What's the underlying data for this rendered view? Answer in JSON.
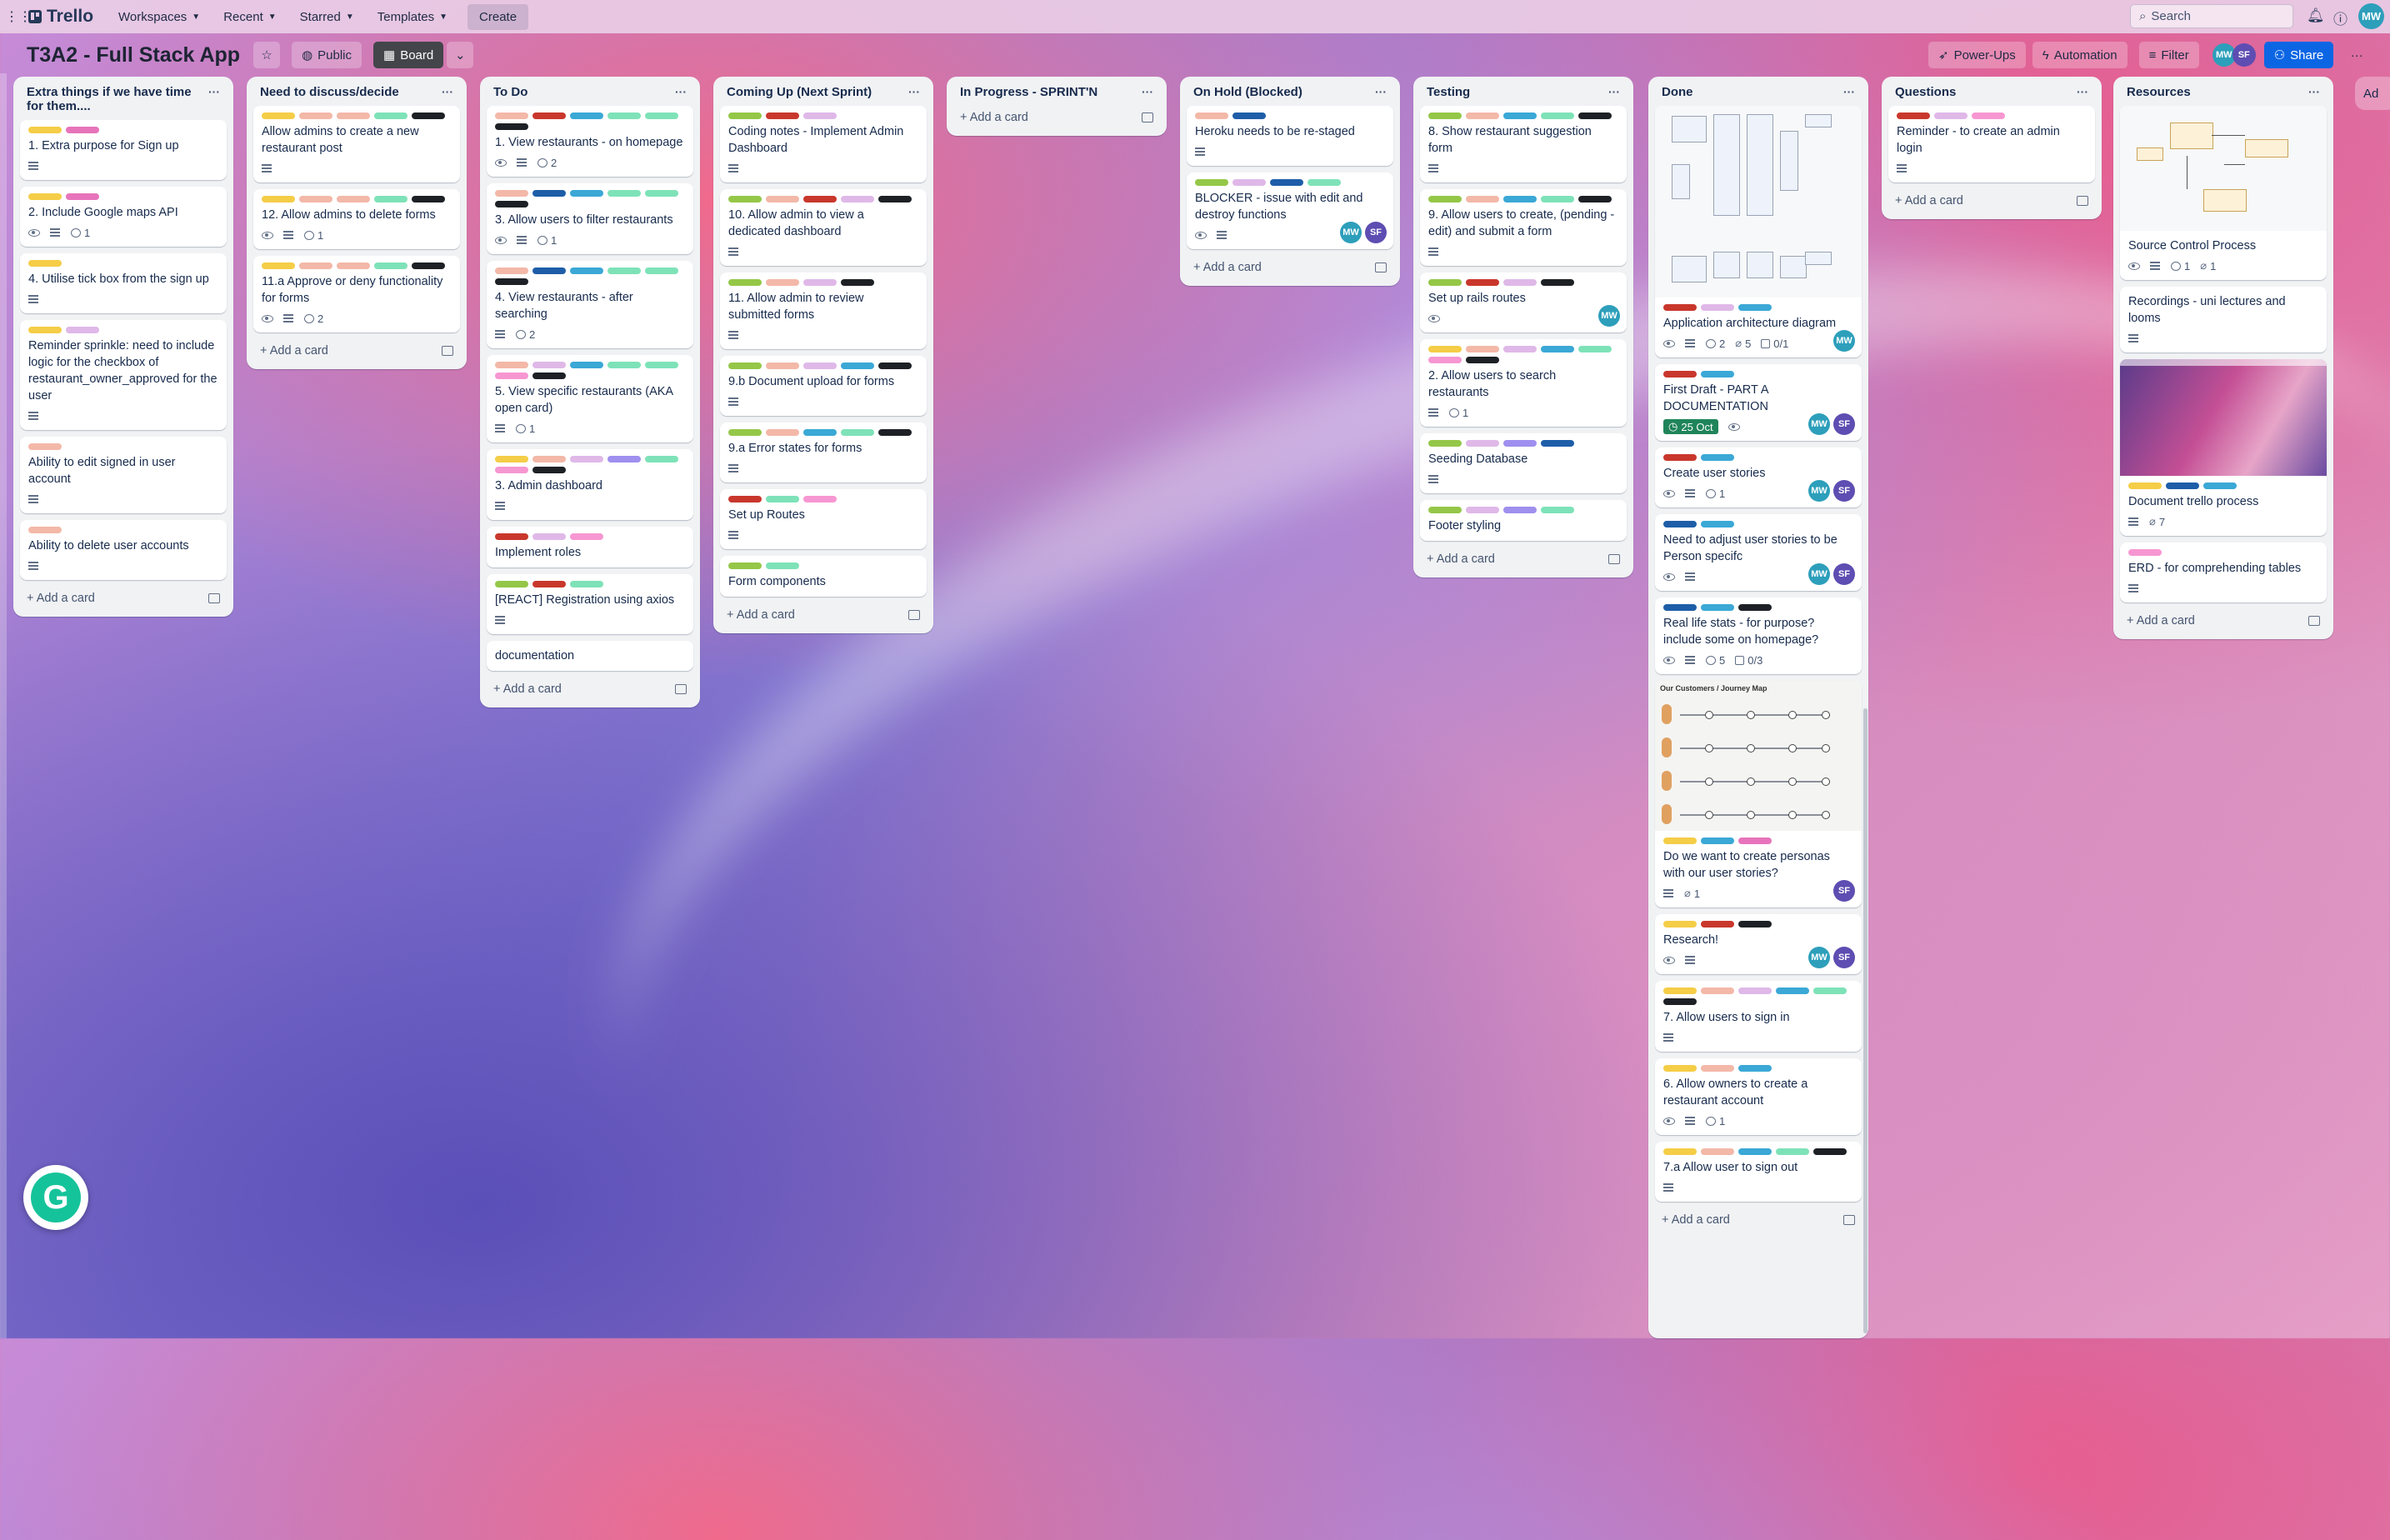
{
  "nav": {
    "logo": "Trello",
    "items": [
      "Workspaces",
      "Recent",
      "Starred",
      "Templates"
    ],
    "create": "Create",
    "search_placeholder": "Search",
    "user_initials": "MW"
  },
  "board": {
    "title": "T3A2 - Full Stack App",
    "visibility": "Public",
    "view": "Board",
    "powerups": "Power-Ups",
    "automation": "Automation",
    "filter": "Filter",
    "share": "Share",
    "member1": "MW",
    "member2": "SF"
  },
  "add_card_label": "Add a card",
  "add_list_label": "Ad",
  "colors": {
    "yellow": "#e2b203",
    "pink": "#e774bb",
    "salmon": "#f87462",
    "peach": "#f3b8a8",
    "green": "#4bce97",
    "lgreen": "#7ee2b8",
    "lime": "#94c748",
    "blue": "#579dff",
    "cyan": "#6cc3e0",
    "navy": "#1d2125",
    "teal": "#60c6d2",
    "red": "#c9372c",
    "lavender": "#dfb8e8",
    "purple": "#9f8fef",
    "dblue": "#0c66e4",
    "sky": "#3ba8d6",
    "darkblue": "#1e5ea8",
    "lpink": "#f797d2",
    "orange": "#fea362",
    "lyellow": "#f5cd47"
  },
  "lists": [
    {
      "title": "Extra things if we have time for them....",
      "cards": [
        {
          "labels": [
            "lyellow",
            "pink"
          ],
          "title": "1. Extra purpose for Sign up",
          "desc": true
        },
        {
          "labels": [
            "lyellow",
            "pink"
          ],
          "title": "2. Include Google maps API",
          "eye": true,
          "desc": true,
          "comments": "1"
        },
        {
          "labels": [
            "lyellow"
          ],
          "title": "4. Utilise tick box from the sign up",
          "desc": true
        },
        {
          "labels": [
            "lyellow",
            "lavender"
          ],
          "title": "Reminder sprinkle: need to include logic for the checkbox of restaurant_owner_approved for the user",
          "desc": true
        },
        {
          "labels": [
            "peach"
          ],
          "title": "Ability to edit signed in user account",
          "desc": true
        },
        {
          "labels": [
            "peach"
          ],
          "title": "Ability to delete user accounts",
          "desc": true
        }
      ]
    },
    {
      "title": "Need to discuss/decide",
      "cards": [
        {
          "labels": [
            "lyellow",
            "peach",
            "peach",
            "lgreen",
            "navy"
          ],
          "title": "Allow admins to create a new restaurant post",
          "desc": true
        },
        {
          "labels": [
            "lyellow",
            "peach",
            "peach",
            "lgreen",
            "navy"
          ],
          "title": "12. Allow admins to delete forms",
          "eye": true,
          "desc": true,
          "comments": "1"
        },
        {
          "labels": [
            "lyellow",
            "peach",
            "peach",
            "lgreen",
            "navy"
          ],
          "title": "11.a Approve or deny functionality for forms",
          "eye": true,
          "desc": true,
          "comments": "2"
        }
      ]
    },
    {
      "title": "To Do",
      "cards": [
        {
          "labels": [
            "peach",
            "red",
            "sky",
            "lgreen",
            "lgreen",
            "navy"
          ],
          "title": "1. View restaurants - on homepage",
          "eye": true,
          "desc": true,
          "comments": "2"
        },
        {
          "labels": [
            "peach",
            "darkblue",
            "sky",
            "lgreen",
            "lgreen",
            "navy"
          ],
          "title": "3. Allow users to filter restaurants",
          "eye": true,
          "desc": true,
          "comments": "1"
        },
        {
          "labels": [
            "peach",
            "darkblue",
            "sky",
            "lgreen",
            "lgreen",
            "navy"
          ],
          "title": "4. View restaurants - after searching",
          "desc": true,
          "comments": "2"
        },
        {
          "labels": [
            "peach",
            "lavender",
            "sky",
            "lgreen",
            "lgreen",
            "lpink",
            "navy"
          ],
          "title": "5. View specific restaurants (AKA open card)",
          "desc": true,
          "comments": "1"
        },
        {
          "labels": [
            "lyellow",
            "peach",
            "lavender",
            "purple",
            "lgreen",
            "lpink",
            "navy"
          ],
          "title": "3. Admin dashboard",
          "desc": true
        },
        {
          "labels": [
            "red",
            "lavender",
            "lpink"
          ],
          "title": "Implement roles"
        },
        {
          "labels": [
            "lime",
            "red",
            "lgreen"
          ],
          "title": "[REACT] Registration using axios",
          "desc": true
        },
        {
          "labels": [],
          "title": "documentation"
        }
      ]
    },
    {
      "title": "Coming Up (Next Sprint)",
      "cards": [
        {
          "labels": [
            "lime",
            "red",
            "lavender"
          ],
          "title": "Coding notes - Implement Admin Dashboard",
          "desc": true
        },
        {
          "labels": [
            "lime",
            "peach",
            "red",
            "lavender",
            "navy"
          ],
          "title": "10. Allow admin to view a dedicated dashboard",
          "desc": true
        },
        {
          "labels": [
            "lime",
            "peach",
            "lavender",
            "navy"
          ],
          "title": "11. Allow admin to review submitted forms",
          "desc": true
        },
        {
          "labels": [
            "lime",
            "peach",
            "lavender",
            "sky",
            "navy"
          ],
          "title": "9.b Document upload for forms",
          "desc": true
        },
        {
          "labels": [
            "lime",
            "peach",
            "sky",
            "lgreen",
            "navy"
          ],
          "title": "9.a Error states for forms",
          "desc": true
        },
        {
          "labels": [
            "red",
            "lgreen",
            "lpink"
          ],
          "title": "Set up Routes",
          "desc": true
        },
        {
          "labels": [
            "lime",
            "lgreen"
          ],
          "title": "Form components"
        }
      ]
    },
    {
      "title": "In Progress - SPRINT'N",
      "cards": []
    },
    {
      "title": "On Hold (Blocked)",
      "cards": [
        {
          "labels": [
            "peach",
            "darkblue"
          ],
          "title": "Heroku needs to be re-staged",
          "desc": true
        },
        {
          "labels": [
            "lime",
            "lavender",
            "darkblue",
            "lgreen"
          ],
          "title": "BLOCKER - issue with edit and destroy functions",
          "eye": true,
          "desc": true,
          "members": [
            "MW",
            "SF"
          ]
        }
      ]
    },
    {
      "title": "Testing",
      "cards": [
        {
          "labels": [
            "lime",
            "peach",
            "sky",
            "lgreen",
            "navy"
          ],
          "title": "8. Show restaurant suggestion form",
          "desc": true
        },
        {
          "labels": [
            "lime",
            "peach",
            "sky",
            "lgreen",
            "navy"
          ],
          "title": "9. Allow users to create, (pending - edit) and submit a form",
          "desc": true
        },
        {
          "labels": [
            "lime",
            "red",
            "lavender",
            "navy"
          ],
          "title": "Set up rails routes",
          "eye": true,
          "members": [
            "MW"
          ]
        },
        {
          "labels": [
            "lyellow",
            "peach",
            "lavender",
            "sky",
            "lgreen",
            "lpink",
            "navy"
          ],
          "title": "2. Allow users to search restaurants",
          "desc": true,
          "comments": "1"
        },
        {
          "labels": [
            "lime",
            "lavender",
            "purple",
            "darkblue"
          ],
          "title": "Seeding Database",
          "desc": true
        },
        {
          "labels": [
            "lime",
            "lavender",
            "purple",
            "lgreen"
          ],
          "title": "Footer styling"
        }
      ]
    },
    {
      "title": "Done",
      "cards": [
        {
          "cover": "diagram",
          "labels": [
            "red",
            "lavender",
            "sky"
          ],
          "title": "Application architecture diagram",
          "eye": true,
          "desc": true,
          "comments": "2",
          "attach": "5",
          "check": "0/1",
          "members": [
            "MW"
          ]
        },
        {
          "labels": [
            "red",
            "sky"
          ],
          "title": "First Draft - PART A DOCUMENTATION",
          "eye": true,
          "due": "25 Oct",
          "members": [
            "MW",
            "SF"
          ]
        },
        {
          "labels": [
            "red",
            "sky"
          ],
          "title": "Create user stories",
          "eye": true,
          "desc": true,
          "comments": "1",
          "members": [
            "MW",
            "SF"
          ]
        },
        {
          "labels": [
            "darkblue",
            "sky"
          ],
          "title": "Need to adjust user stories to be Person specifc",
          "eye": true,
          "desc": true,
          "members": [
            "MW",
            "SF"
          ]
        },
        {
          "labels": [
            "darkblue",
            "sky",
            "navy"
          ],
          "title": "Real life stats - for purpose? include some on homepage?",
          "eye": true,
          "desc": true,
          "comments": "5",
          "check": "0/3"
        },
        {
          "cover": "journey",
          "cover_title": "Our Customers / Journey Map",
          "labels": [
            "lyellow",
            "sky",
            "pink"
          ],
          "title": "Do we want to create personas with our user stories?",
          "desc": true,
          "attach": "1",
          "members": [
            "SF"
          ]
        },
        {
          "labels": [
            "lyellow",
            "red",
            "navy"
          ],
          "title": "Research!",
          "eye": true,
          "desc": true,
          "members": [
            "MW",
            "SF"
          ]
        },
        {
          "labels": [
            "lyellow",
            "peach",
            "lavender",
            "sky",
            "lgreen",
            "navy"
          ],
          "title": "7. Allow users to sign in",
          "desc": true
        },
        {
          "labels": [
            "lyellow",
            "peach",
            "sky"
          ],
          "title": "6. Allow owners to create a restaurant account",
          "eye": true,
          "desc": true,
          "comments": "1"
        },
        {
          "labels": [
            "lyellow",
            "peach",
            "sky",
            "lgreen",
            "navy"
          ],
          "title": "7.a Allow user to sign out",
          "desc": true
        }
      ]
    },
    {
      "title": "Questions",
      "cards": [
        {
          "labels": [
            "red",
            "lavender",
            "lpink"
          ],
          "title": "Reminder - to create an admin login",
          "desc": true
        }
      ]
    },
    {
      "title": "Resources",
      "cards": [
        {
          "cover": "flow",
          "labels": [],
          "title": "Source Control Process",
          "eye": true,
          "desc": true,
          "comments": "1",
          "attach": "1"
        },
        {
          "labels": [],
          "title": "Recordings - uni lectures and looms",
          "desc": true
        },
        {
          "cover": "screen",
          "labels": [
            "lyellow",
            "darkblue",
            "sky"
          ],
          "title": "Document trello process",
          "desc": true,
          "attach": "7"
        },
        {
          "labels": [
            "lpink"
          ],
          "title": "ERD - for comprehending tables",
          "desc": true
        }
      ]
    }
  ]
}
